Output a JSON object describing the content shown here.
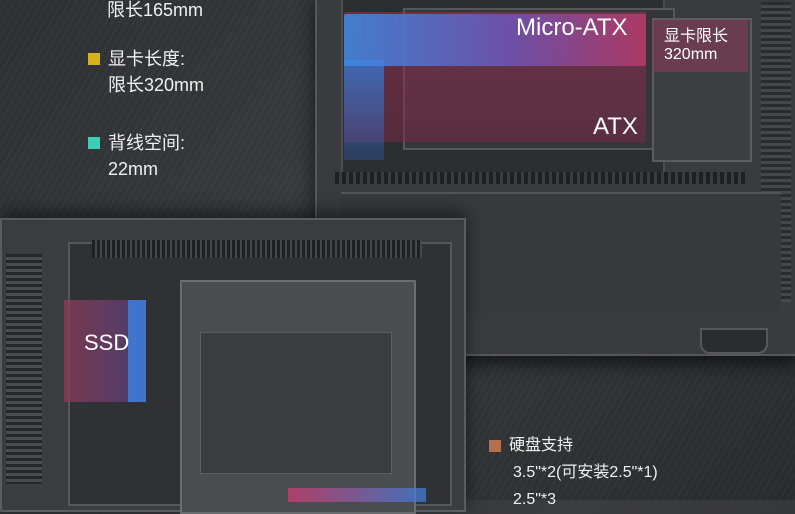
{
  "specs": {
    "cpu_cooler": {
      "value": "限长165mm"
    },
    "gpu": {
      "label": "显卡长度:",
      "value": "限长320mm",
      "color": "#d8b21a"
    },
    "cable": {
      "label": "背线空间:",
      "value": "22mm",
      "color": "#3ccfb8"
    },
    "storage": {
      "label": "硬盘支持",
      "lines": [
        "3.5\"*2(可安装2.5\"*1)",
        "2.5\"*3"
      ],
      "color": "#b5704f"
    }
  },
  "diagram": {
    "matx_label": "Micro-ATX",
    "atx_label": "ATX",
    "gpu_limit_label": [
      "显卡限长",
      "320mm"
    ],
    "ssd_label": "SSD"
  }
}
